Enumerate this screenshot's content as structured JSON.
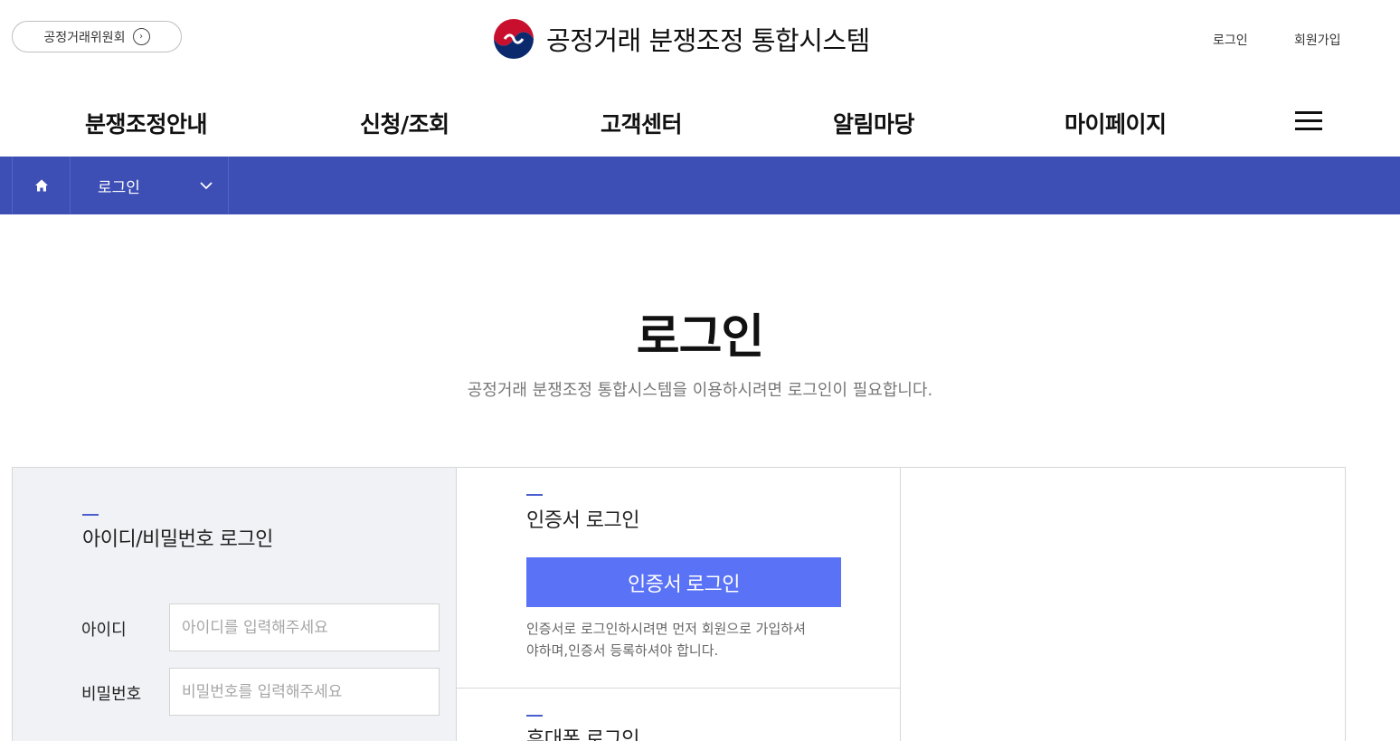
{
  "header": {
    "ftc_link_label": "공정거래위원회",
    "site_title": "공정거래 분쟁조정 통합시스템",
    "util": {
      "login": "로그인",
      "signup": "회원가입"
    }
  },
  "nav": {
    "items": [
      {
        "label": "분쟁조정안내"
      },
      {
        "label": "신청/조회"
      },
      {
        "label": "고객센터"
      },
      {
        "label": "알림마당"
      },
      {
        "label": "마이페이지"
      }
    ]
  },
  "breadcrumb": {
    "current": "로그인"
  },
  "page": {
    "title": "로그인",
    "subtitle": "공정거래 분쟁조정 통합시스템을 이용하시려면 로그인이 필요합니다."
  },
  "id_login": {
    "title": "아이디/비밀번호 로그인",
    "id_label": "아이디",
    "id_placeholder": "아이디를 입력해주세요",
    "pw_label": "비밀번호",
    "pw_placeholder": "비밀번호를 입력해주세요"
  },
  "cert_login": {
    "title": "인증서 로그인",
    "button": "인증서 로그인",
    "desc_line1": "인증서로 로그인하시려면 먼저 회원으로 가입하셔",
    "desc_line2": "야하며,인증서 등록하셔야 합니다."
  },
  "phone_login": {
    "title": "휴대폰 로그인"
  },
  "colors": {
    "nav_bar": "#3d4fb5",
    "cert_button": "#5a72f5",
    "accent": "#4a5fcf",
    "panel_bg": "#f1f2f6"
  }
}
